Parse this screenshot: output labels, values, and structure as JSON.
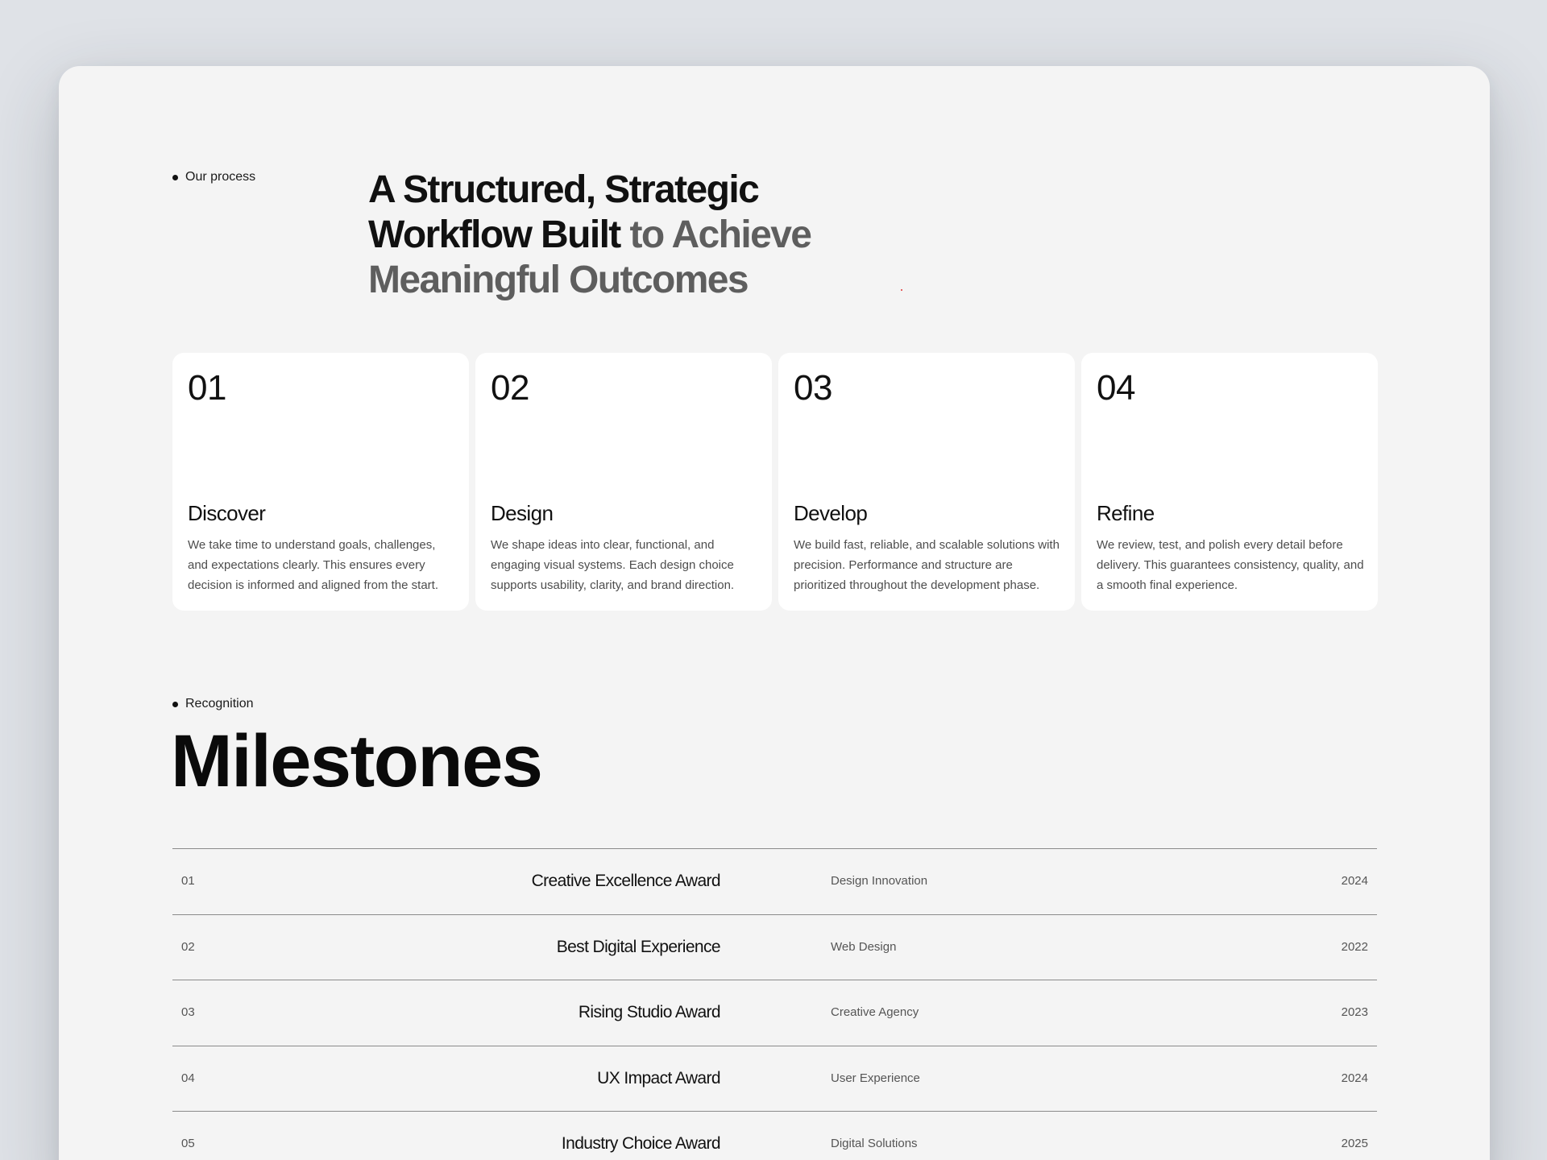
{
  "process": {
    "eyebrow": "Our process",
    "headline_dark": "A Structured, Strategic Workflow Built",
    "headline_muted": "to Achieve Meaningful Outcomes",
    "steps": [
      {
        "num": "01",
        "title": "Discover",
        "desc": "We take time to understand goals, challenges, and expectations clearly. This ensures every decision is informed and aligned from the start."
      },
      {
        "num": "02",
        "title": "Design",
        "desc": "We shape ideas into clear, functional, and engaging visual systems. Each design choice supports usability, clarity, and brand direction."
      },
      {
        "num": "03",
        "title": "Develop",
        "desc": "We build fast, reliable, and scalable solutions with precision. Performance and structure are prioritized throughout the development phase."
      },
      {
        "num": "04",
        "title": "Refine",
        "desc": "We review, test, and polish every detail before delivery. This guarantees consistency, quality, and a smooth final experience."
      }
    ]
  },
  "recognition": {
    "eyebrow": "Recognition",
    "title": "Milestones",
    "rows": [
      {
        "idx": "01",
        "award": "Creative Excellence Award",
        "category": "Design Innovation",
        "year": "2024"
      },
      {
        "idx": "02",
        "award": "Best Digital Experience",
        "category": "Web Design",
        "year": "2022"
      },
      {
        "idx": "03",
        "award": "Rising Studio Award",
        "category": "Creative Agency",
        "year": "2023"
      },
      {
        "idx": "04",
        "award": "UX Impact Award",
        "category": "User Experience",
        "year": "2024"
      },
      {
        "idx": "05",
        "award": "Industry Choice Award",
        "category": "Digital Solutions",
        "year": "2025"
      }
    ]
  },
  "colors": {
    "page_bg": "#dfe2e7",
    "frame_bg": "#f4f4f4",
    "card_bg": "#ffffff",
    "text_dark": "#111111",
    "text_muted": "#5e5e5e"
  }
}
